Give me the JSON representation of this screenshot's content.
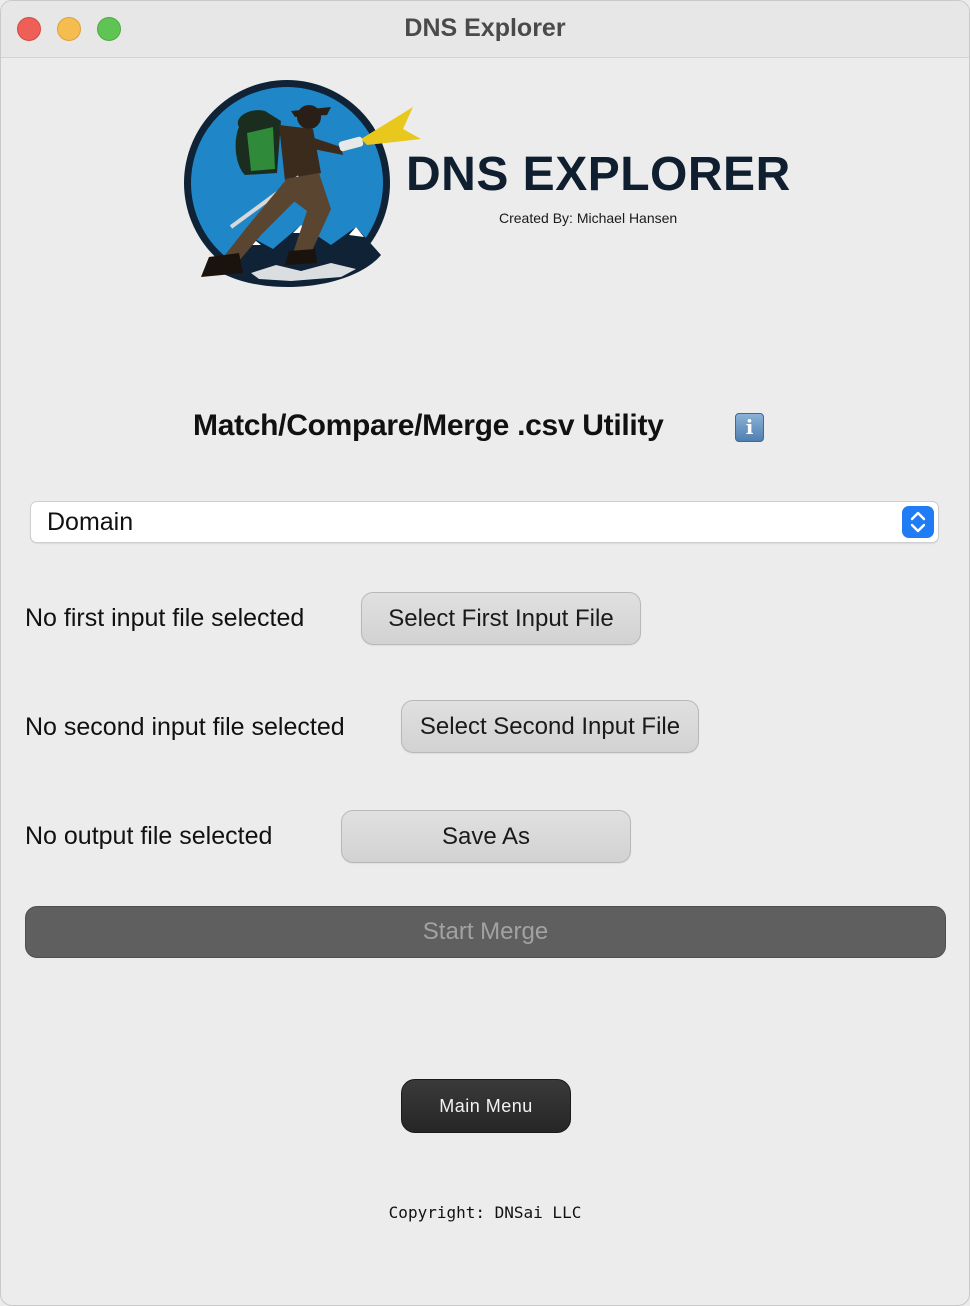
{
  "window": {
    "title": "DNS Explorer",
    "controls": [
      "close",
      "minimize",
      "zoom"
    ]
  },
  "header": {
    "brand": "DNS EXPLORER",
    "creator": "Created By: Michael Hansen",
    "logo_icon": "explorer-with-flashlight-logo"
  },
  "utility": {
    "title": "Match/Compare/Merge .csv Utility",
    "info_icon": "i"
  },
  "select": {
    "value": "Domain"
  },
  "inputs": {
    "first": {
      "status": "No first input file selected",
      "button": "Select First Input File"
    },
    "second": {
      "status": "No second input file selected",
      "button": "Select Second Input File"
    },
    "output": {
      "status": "No output file selected",
      "button": "Save As"
    }
  },
  "actions": {
    "start_merge": "Start Merge",
    "main_menu": "Main Menu"
  },
  "footer": {
    "copyright": "Copyright: DNSai LLC"
  },
  "colors": {
    "background": "#ececec",
    "brand_text": "#0f1f30",
    "logo_blue": "#1f86c7",
    "accent_yellow": "#e8c81c",
    "select_stepper": "#1f7cf5",
    "merge_button": "#5f5f5f",
    "main_menu_button": "#2e2e2e"
  }
}
